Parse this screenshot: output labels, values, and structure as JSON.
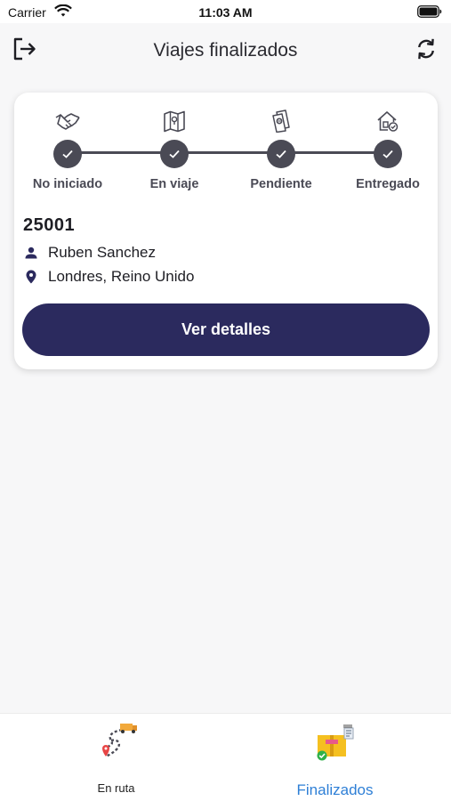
{
  "status_bar": {
    "carrier": "Carrier",
    "time": "11:03 AM"
  },
  "header": {
    "title": "Viajes finalizados",
    "left_icon": "logout-icon",
    "right_icon": "refresh-icon"
  },
  "trip": {
    "steps": [
      {
        "label": "No iniciado",
        "icon": "handshake-icon",
        "done": true
      },
      {
        "label": "En viaje",
        "icon": "map-icon",
        "done": true
      },
      {
        "label": "Pendiente",
        "icon": "document-icon",
        "done": true
      },
      {
        "label": "Entregado",
        "icon": "home-delivered-icon",
        "done": true
      }
    ],
    "id": "25001",
    "driver": "Ruben Sanchez",
    "location": "Londres, Reino Unido",
    "button_label": "Ver detalles"
  },
  "bottom_nav": {
    "items": [
      {
        "label": "En ruta",
        "icon": "route-truck-icon",
        "active": false
      },
      {
        "label": "Finalizados",
        "icon": "delivered-boxes-icon",
        "active": true
      }
    ]
  },
  "colors": {
    "primary": "#2b2a5e",
    "step": "#4a4a55",
    "active_tab": "#2e7fd6",
    "background": "#f7f7f8"
  }
}
